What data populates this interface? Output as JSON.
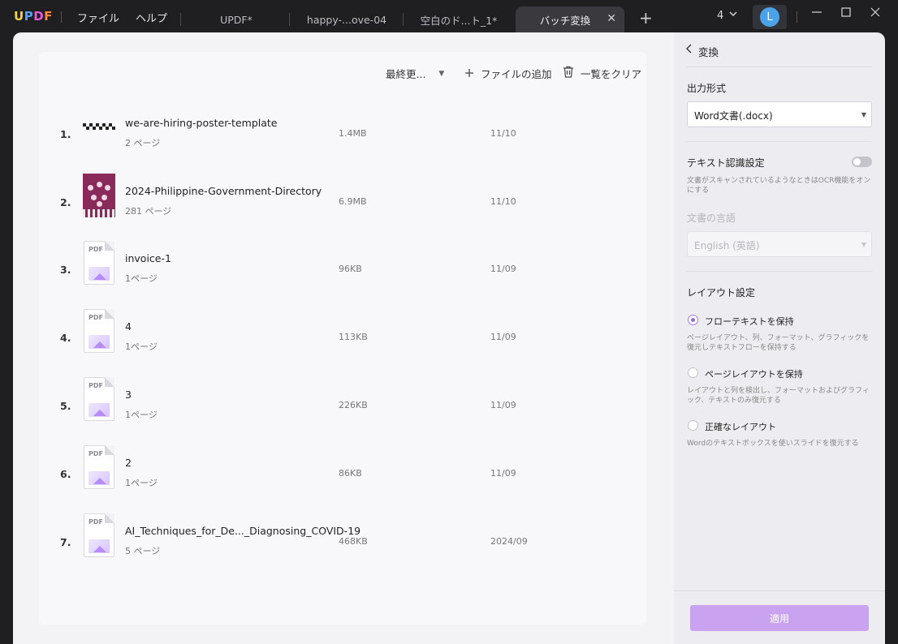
{
  "app": {
    "logo": [
      "U",
      "P",
      "D",
      "F"
    ],
    "menu": [
      "ファイル",
      "ヘルプ"
    ]
  },
  "tabs": [
    {
      "label": "UPDF*"
    },
    {
      "label": "happy-...ove-04"
    },
    {
      "label": "空白のド...ト_1*"
    },
    {
      "label": "バッチ変換",
      "active": true
    }
  ],
  "window": {
    "tab_count": "4",
    "avatar_initial": "L"
  },
  "toolbar": {
    "sort_label": "最終更...",
    "add_files": "ファイルの追加",
    "clear_list": "一覧をクリア"
  },
  "files": [
    {
      "index": "1.",
      "name": "we-are-hiring-poster-template",
      "pages": "2 ページ",
      "size": "1.4MB",
      "date": "11/10",
      "thumb": "poster"
    },
    {
      "index": "2.",
      "name": "2024-Philippine-Government-Directory",
      "pages": "281 ページ",
      "size": "6.9MB",
      "date": "11/10",
      "thumb": "directory"
    },
    {
      "index": "3.",
      "name": "invoice-1",
      "pages": "1ページ",
      "size": "96KB",
      "date": "11/09",
      "thumb": "pdf"
    },
    {
      "index": "4.",
      "name": "4",
      "pages": "1ページ",
      "size": "113KB",
      "date": "11/09",
      "thumb": "pdf"
    },
    {
      "index": "5.",
      "name": "3",
      "pages": "1ページ",
      "size": "226KB",
      "date": "11/09",
      "thumb": "pdf"
    },
    {
      "index": "6.",
      "name": "2",
      "pages": "1ページ",
      "size": "86KB",
      "date": "11/09",
      "thumb": "pdf"
    },
    {
      "index": "7.",
      "name": "AI_Techniques_for_De..._Diagnosing_COVID-19",
      "pages": "5 ページ",
      "size": "468KB",
      "date": "2024/09",
      "thumb": "pdf"
    }
  ],
  "pdf_label": "PDF",
  "panel": {
    "title": "変換",
    "output_format_label": "出力形式",
    "output_format_value": "Word文書(.docx)",
    "ocr_label": "テキスト認識設定",
    "ocr_enabled": false,
    "ocr_desc": "文書がスキャンされているようなときはOCR機能をオンにする",
    "language_label": "文書の言語",
    "language_value": "English (英語)",
    "layout_label": "レイアウト設定",
    "layout_options": [
      {
        "label": "フローテキストを保持",
        "desc": "ページレイアウト、列、フォーマット、グラフィックを復元しテキストフローを保持する",
        "selected": true
      },
      {
        "label": "ページレイアウトを保持",
        "desc": "レイアウトと列を検出し、フォーマットおよびグラフィック、テキストのみ復元する",
        "selected": false
      },
      {
        "label": "正確なレイアウト",
        "desc": "Wordのテキストボックスを使いスライドを復元する",
        "selected": false
      }
    ],
    "apply_label": "適用"
  },
  "colors": {
    "accent": "#9a6ae3",
    "apply_button": "#c9a2f0",
    "titlebar": "#1f1f22"
  }
}
